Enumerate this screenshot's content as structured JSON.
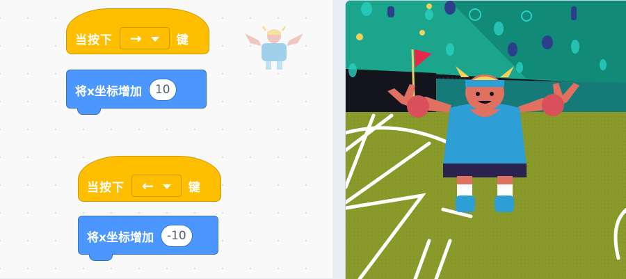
{
  "scripts": [
    {
      "hat_label": "当按下",
      "key_value": "→",
      "key_suffix": "键",
      "motion_label": "将x坐标增加",
      "motion_value": "10"
    },
    {
      "hat_label": "当按下",
      "key_value": "←",
      "key_suffix": "键",
      "motion_label": "将x坐标增加",
      "motion_value": "-10"
    }
  ],
  "colors": {
    "events_block": "#ffbf00",
    "motion_block": "#4c97ff",
    "field_green": "#8a9a2a",
    "stadium_teal": "#1f9a8a"
  },
  "icons": [
    "caret-down-icon",
    "sprite-thumbnail",
    "corner-flag-icon"
  ]
}
